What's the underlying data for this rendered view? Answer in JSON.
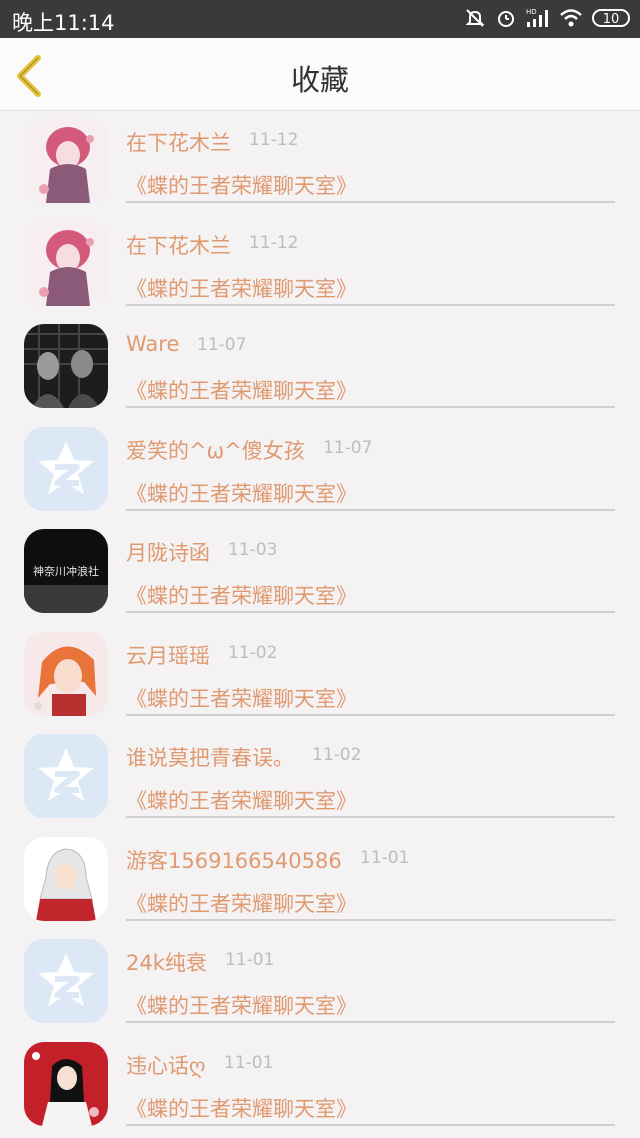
{
  "status_bar": {
    "time": "晚上11:14",
    "network": "HD",
    "battery": "10"
  },
  "nav": {
    "title": "收藏"
  },
  "items": [
    {
      "name": "在下花木兰",
      "date": "11-12",
      "room": "《蝶的王者荣耀聊天室》",
      "avatar": "anime-girl-pink-avatar"
    },
    {
      "name": "在下花木兰",
      "date": "11-12",
      "room": "《蝶的王者荣耀聊天室》",
      "avatar": "anime-girl-pink-avatar"
    },
    {
      "name": "Ware",
      "date": "11-07",
      "room": "《蝶的王者荣耀聊天室》",
      "avatar": "dark-photo-avatar"
    },
    {
      "name": "爱笑的^ω^傻女孩",
      "date": "11-07",
      "room": "《蝶的王者荣耀聊天室》",
      "avatar": "qzone-star-default-avatar"
    },
    {
      "name": "月陇诗函",
      "date": "11-03",
      "room": "《蝶的王者荣耀聊天室》",
      "avatar": "black-calligraphy-avatar",
      "avatar_text": "神奈川冲浪社"
    },
    {
      "name": "云月瑶瑶",
      "date": "11-02",
      "room": "《蝶的王者荣耀聊天室》",
      "avatar": "anime-redhead-avatar"
    },
    {
      "name": "谁说莫把青春误。",
      "date": "11-02",
      "room": "《蝶的王者荣耀聊天室》",
      "avatar": "qzone-star-default-avatar"
    },
    {
      "name": "游客1569166540586",
      "date": "11-01",
      "room": "《蝶的王者荣耀聊天室》",
      "avatar": "anime-white-hair-avatar"
    },
    {
      "name": "24k纯衰",
      "date": "11-01",
      "room": "《蝶的王者荣耀聊天室》",
      "avatar": "qzone-star-default-avatar"
    },
    {
      "name": "违心话ღ",
      "date": "11-01",
      "room": "《蝶的王者荣耀聊天室》",
      "avatar": "anime-red-kimono-avatar"
    }
  ]
}
